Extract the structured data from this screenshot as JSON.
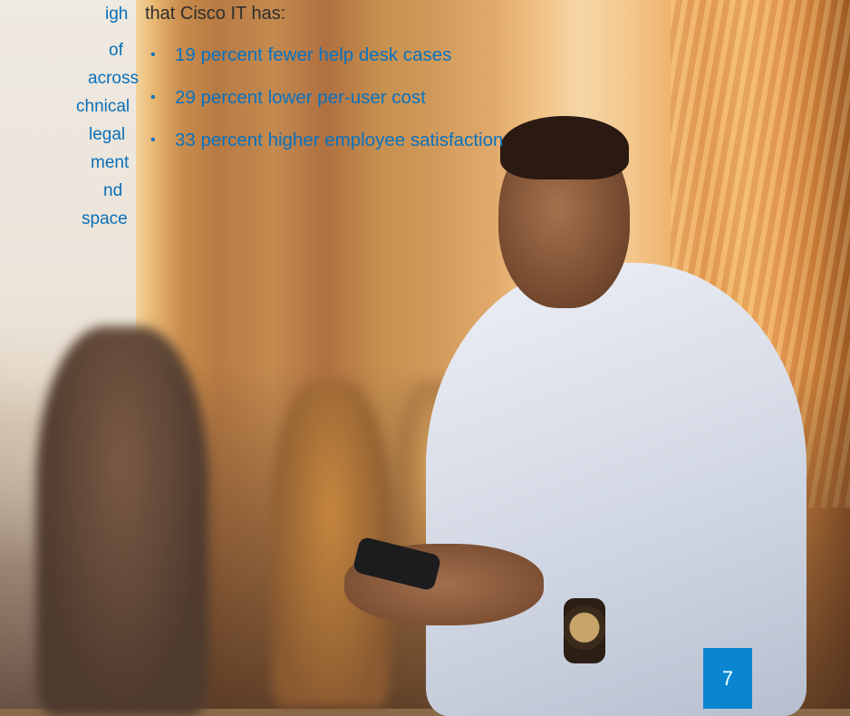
{
  "left_column": {
    "lines": [
      "igh",
      "",
      "of",
      "across",
      "chnical",
      " legal",
      "ment",
      "nd",
      "space"
    ]
  },
  "intro_text": "that Cisco IT has:",
  "bullets": [
    "19 percent fewer help desk cases",
    "29 percent lower per-user cost",
    "33 percent higher employee satisfaction"
  ],
  "bullet_glyph": "•",
  "page_number": "7",
  "colors": {
    "accent_blue": "#0a72bf",
    "page_badge": "#0a86d0"
  },
  "photo": {
    "subject": "photo-man-with-smartphone"
  }
}
